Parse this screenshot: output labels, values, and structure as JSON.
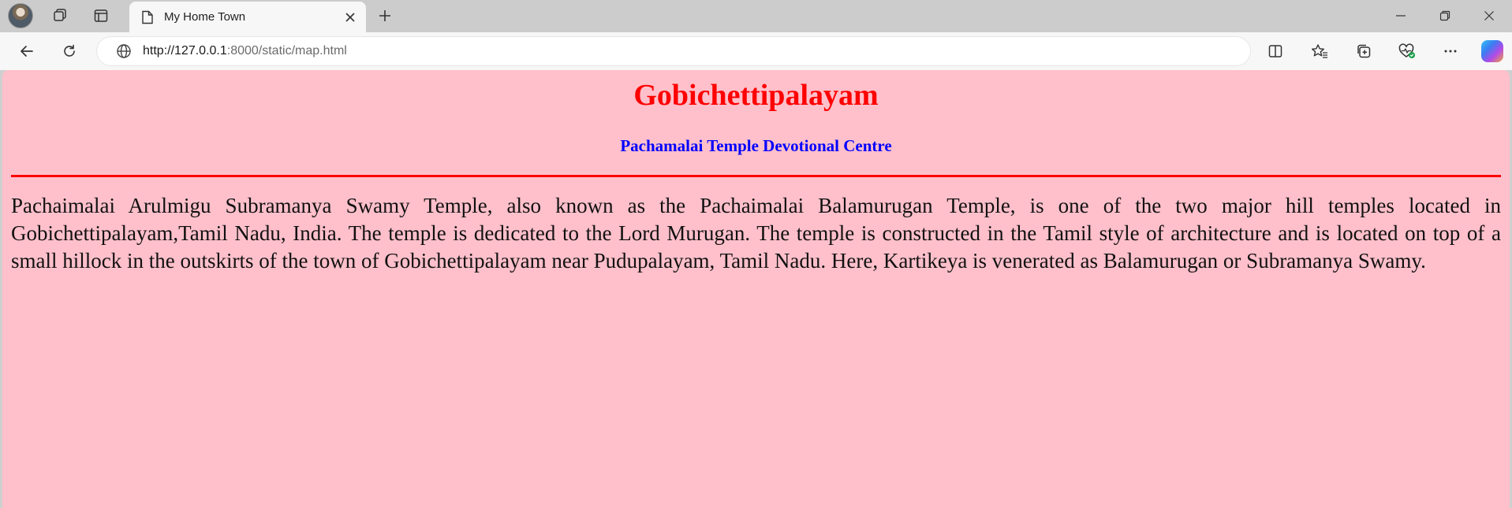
{
  "browser": {
    "tab": {
      "title": "My Home Town"
    },
    "address": {
      "url_host": "http://127.0.0.1",
      "url_rest": ":8000/static/map.html"
    }
  },
  "page": {
    "heading": "Gobichettipalayam",
    "subheading": "Pachamalai Temple Devotional Centre",
    "paragraph": "Pachaimalai Arulmigu Subramanya Swamy Temple, also known as the Pachaimalai Balamurugan Temple, is one of the two major hill temples located in Gobichettipalayam,Tamil Nadu, India. The temple is dedicated to the Lord Murugan. The temple is constructed in the Tamil style of architecture and is located on top of a small hillock in the outskirts of the town of Gobichettipalayam near Pudupalayam, Tamil Nadu. Here, Kartikeya is venerated as Balamurugan or Subramanya Swamy."
  },
  "colors": {
    "page_background": "#ffc0cb",
    "heading": "#ff0000",
    "subheading": "#0000ff",
    "rule": "#ff0000"
  }
}
